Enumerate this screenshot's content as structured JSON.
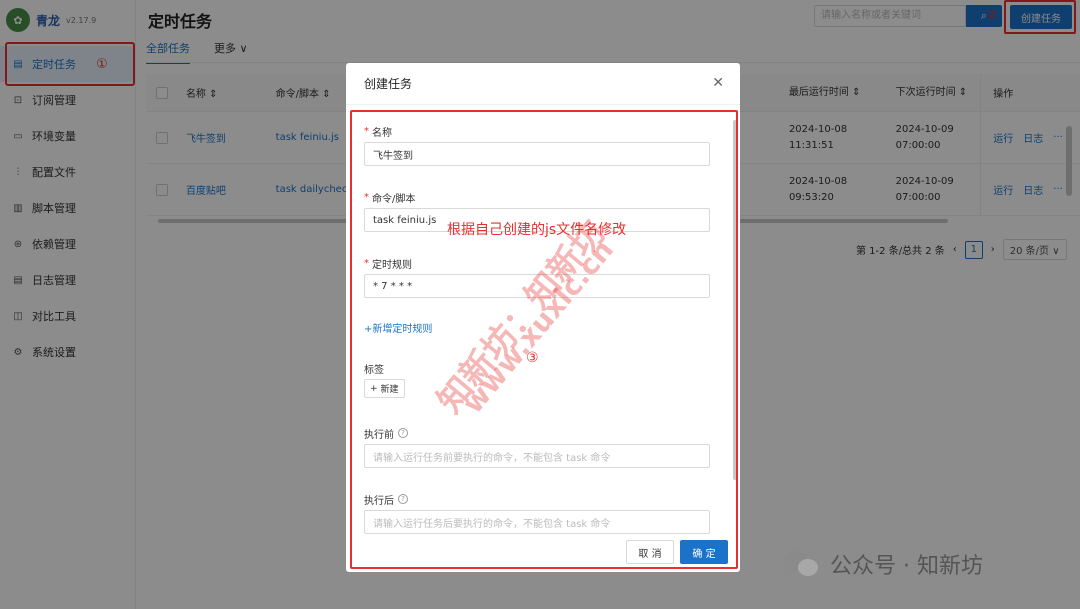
{
  "app": {
    "name": "青龙",
    "version": "v2.17.9"
  },
  "sidebar": {
    "items": [
      {
        "label": "定时任务",
        "icon": "clock-icon",
        "active": true
      },
      {
        "label": "订阅管理",
        "icon": "subscribe-icon"
      },
      {
        "label": "环境变量",
        "icon": "env-icon"
      },
      {
        "label": "配置文件",
        "icon": "config-icon"
      },
      {
        "label": "脚本管理",
        "icon": "script-icon"
      },
      {
        "label": "依赖管理",
        "icon": "dependency-icon"
      },
      {
        "label": "日志管理",
        "icon": "log-icon"
      },
      {
        "label": "对比工具",
        "icon": "compare-icon"
      },
      {
        "label": "系统设置",
        "icon": "settings-icon"
      }
    ]
  },
  "header": {
    "title": "定时任务",
    "search_placeholder": "请输入名称或者关键词",
    "create_button": "创建任务"
  },
  "tabs": [
    "全部任务",
    "更多"
  ],
  "table": {
    "headers": {
      "name": "名称",
      "command": "命令/脚本",
      "last_run": "最后运行时间",
      "next_run": "下次运行时间",
      "ops": "操作"
    },
    "rows": [
      {
        "name": "飞牛签到",
        "command": "task feiniu.js",
        "last_date": "2024-10-08",
        "last_time": "11:31:51",
        "next_date": "2024-10-09",
        "next_time": "07:00:00"
      },
      {
        "name": "百度贴吧",
        "command": "task dailycheck",
        "last_date": "2024-10-08",
        "last_time": "09:53:20",
        "next_date": "2024-10-09",
        "next_time": "07:00:00"
      }
    ],
    "op_run": "运行",
    "op_log": "日志",
    "op_more": "···"
  },
  "pagination": {
    "summary": "第 1-2 条/总共 2 条",
    "page": "1",
    "size": "20 条/页"
  },
  "modal": {
    "title": "创建任务",
    "name_label": "名称",
    "name_value": "飞牛签到",
    "command_label": "命令/脚本",
    "command_value": "task feiniu.js",
    "schedule_label": "定时规则",
    "schedule_value": "* 7 * * *",
    "add_schedule": "+新增定时规则",
    "tags_label": "标签",
    "tag_new": "新建",
    "before_label": "执行前",
    "before_placeholder": "请输入运行任务前要执行的命令，不能包含 task 命令",
    "after_label": "执行后",
    "after_placeholder": "请输入运行任务后要执行的命令，不能包含 task 命令",
    "cancel": "取 消",
    "ok": "确 定"
  },
  "annotations": {
    "note": "根据自己创建的js文件名修改",
    "mark1": "①",
    "mark2": "②",
    "mark3": "③",
    "watermark_cn": "知新坊：知新坊",
    "watermark_url": "www.xuxlc.cn"
  },
  "wechat_footer": "公众号 · 知新坊",
  "colors": {
    "accent": "#1a73c9",
    "annotation": "#e53030"
  }
}
